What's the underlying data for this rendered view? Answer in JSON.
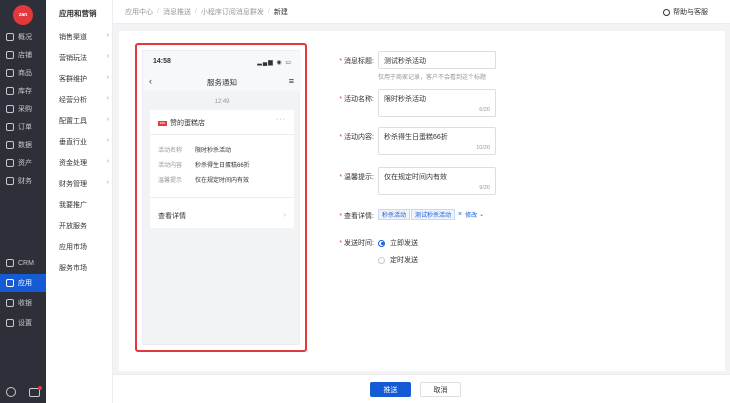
{
  "app": {
    "logo_text": "zan",
    "nav": [
      {
        "label": "概况",
        "icon": "overview-icon"
      },
      {
        "label": "店铺",
        "icon": "store-icon"
      },
      {
        "label": "商品",
        "icon": "goods-icon"
      },
      {
        "label": "库存",
        "icon": "inventory-icon"
      },
      {
        "label": "采购",
        "icon": "purchase-icon"
      },
      {
        "label": "订单",
        "icon": "order-icon"
      },
      {
        "label": "数据",
        "icon": "data-icon"
      },
      {
        "label": "资产",
        "icon": "asset-icon"
      },
      {
        "label": "财务",
        "icon": "finance-icon"
      }
    ],
    "nav_lower": [
      {
        "label": "CRM",
        "icon": "crm-icon"
      },
      {
        "label": "应用",
        "icon": "apps-icon"
      },
      {
        "label": "收银",
        "icon": "cashier-icon"
      },
      {
        "label": "设置",
        "icon": "settings-icon"
      }
    ]
  },
  "subnav": {
    "title": "应用和营销",
    "items": [
      {
        "label": "销售渠道",
        "has_chevron": true
      },
      {
        "label": "营销玩法",
        "has_chevron": true
      },
      {
        "label": "客群维护",
        "has_chevron": true
      },
      {
        "label": "经营分析",
        "has_chevron": true
      },
      {
        "label": "配置工具",
        "has_chevron": true
      },
      {
        "label": "垂直行业",
        "has_chevron": true
      },
      {
        "label": "资金处理",
        "has_chevron": true
      },
      {
        "label": "财务管理",
        "has_chevron": true
      },
      {
        "label": "我要推广",
        "has_chevron": false
      },
      {
        "label": "开放服务",
        "has_chevron": false
      },
      {
        "label": "应用市场",
        "has_chevron": false
      },
      {
        "label": "服务市场",
        "has_chevron": false
      }
    ]
  },
  "header": {
    "breadcrumb": [
      "应用中心",
      "消息推送",
      "小程序订阅消息群发",
      "新建"
    ],
    "help": "帮助与客服"
  },
  "preview": {
    "time": "14:58",
    "title": "服务通知",
    "msg_time": "12:49",
    "shop_logo": "zan",
    "shop": "赞的蛋糕店",
    "more": "···",
    "fields": [
      {
        "k": "活动名称",
        "v": "限时秒杀活动"
      },
      {
        "k": "活动内容",
        "v": "秒杀得生日蛋糕66折"
      },
      {
        "k": "温馨提示",
        "v": "仅在规定时间内有效"
      }
    ],
    "detail": "查看详情"
  },
  "form": {
    "title_label": "消息标题:",
    "title_value": "测试秒杀活动",
    "title_hint": "仅用于商家记录，客户不会看到这个标题",
    "name_label": "活动名称:",
    "name_value": "限时秒杀活动",
    "name_count": "6/20",
    "content_label": "活动内容:",
    "content_value": "秒杀得生日蛋糕66折",
    "content_count": "10/20",
    "tip_label": "温馨提示:",
    "tip_value": "仅在规定时间内有效",
    "tip_count": "9/20",
    "detail_label": "查看详情:",
    "detail_tags": [
      "秒杀活动",
      "测试秒杀活动"
    ],
    "detail_edit": "修改",
    "send_label": "发送时间:",
    "send_options": [
      {
        "label": "立即发送",
        "selected": true
      },
      {
        "label": "定时发送",
        "selected": false
      }
    ]
  },
  "footer": {
    "submit": "推送",
    "cancel": "取消"
  },
  "colors": {
    "accent": "#155bd4",
    "highlight_border": "#e4393c",
    "nav_bg": "#2d3038"
  }
}
